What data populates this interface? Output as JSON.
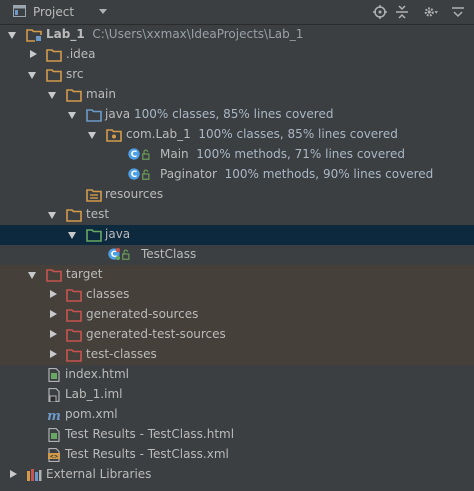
{
  "toolbar": {
    "project_label": "Project",
    "icons": [
      "project-view-icon",
      "dropdown-arrow-icon",
      "locate-icon",
      "collapse-all-icon",
      "settings-icon",
      "hide-icon"
    ]
  },
  "tree": {
    "root": {
      "name": "Lab_1",
      "path": "C:\\Users\\xxmax\\IdeaProjects\\Lab_1"
    },
    "idea": ".idea",
    "src": "src",
    "main": "main",
    "main_java": {
      "name": "java",
      "coverage": "100% classes, 85% lines covered"
    },
    "package": {
      "name": "com.Lab_1",
      "coverage": "100% classes, 85% lines covered"
    },
    "main_class": {
      "name": "Main",
      "coverage": "100% methods, 71% lines covered"
    },
    "paginator_class": {
      "name": "Paginator",
      "coverage": "100% methods, 90% lines covered"
    },
    "resources": "resources",
    "test": "test",
    "test_java": "java",
    "test_class": "TestClass",
    "target": "target",
    "classes": "classes",
    "generated_sources": "generated-sources",
    "generated_test_sources": "generated-test-sources",
    "test_classes": "test-classes",
    "index_html": "index.html",
    "lab_iml": "Lab_1.iml",
    "pom": "pom.xml",
    "results_html": "Test Results - TestClass.html",
    "results_xml": "Test Results - TestClass.xml",
    "external_libs": "External Libraries"
  },
  "colors": {
    "background": "#3c3f41",
    "selection": "#0d293e",
    "excluded_row": "#45403a",
    "folder": "#d29b4c",
    "source_folder": "#6d99c9",
    "test_folder": "#67a862",
    "excluded_folder": "#c75450",
    "class_icon": "#4da0e6"
  }
}
